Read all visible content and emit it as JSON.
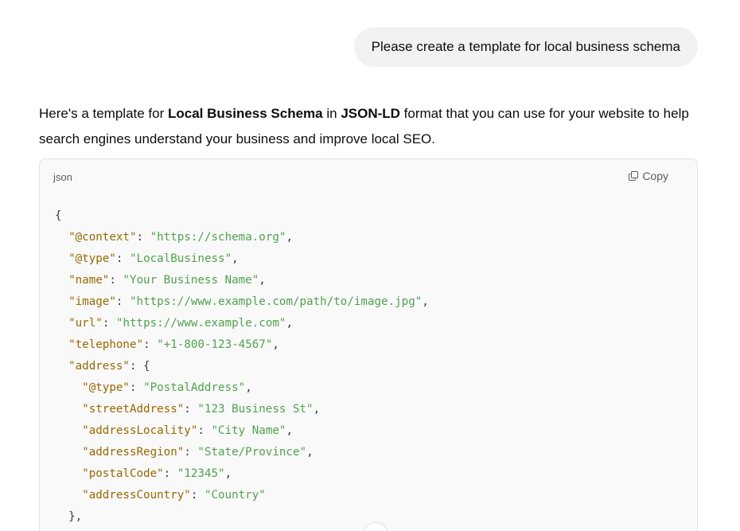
{
  "conversation": {
    "user_message": "Please create a template for local business schema",
    "assistant_intro": {
      "part1": "Here's a template for ",
      "bold1": "Local Business Schema",
      "part2": " in ",
      "bold2": "JSON-LD",
      "part3": " format that you can use for your website to help search engines understand your business and improve local SEO."
    }
  },
  "code_block": {
    "language": "json",
    "copy_label": "Copy",
    "lines": [
      {
        "indent": "",
        "tokens": [
          {
            "t": "p",
            "v": "{"
          }
        ]
      },
      {
        "indent": "  ",
        "tokens": [
          {
            "t": "k",
            "v": "\"@context\""
          },
          {
            "t": "p",
            "v": ": "
          },
          {
            "t": "s",
            "v": "\"https://schema.org\""
          },
          {
            "t": "p",
            "v": ","
          }
        ]
      },
      {
        "indent": "  ",
        "tokens": [
          {
            "t": "k",
            "v": "\"@type\""
          },
          {
            "t": "p",
            "v": ": "
          },
          {
            "t": "s",
            "v": "\"LocalBusiness\""
          },
          {
            "t": "p",
            "v": ","
          }
        ]
      },
      {
        "indent": "  ",
        "tokens": [
          {
            "t": "k",
            "v": "\"name\""
          },
          {
            "t": "p",
            "v": ": "
          },
          {
            "t": "s",
            "v": "\"Your Business Name\""
          },
          {
            "t": "p",
            "v": ","
          }
        ]
      },
      {
        "indent": "  ",
        "tokens": [
          {
            "t": "k",
            "v": "\"image\""
          },
          {
            "t": "p",
            "v": ": "
          },
          {
            "t": "s",
            "v": "\"https://www.example.com/path/to/image.jpg\""
          },
          {
            "t": "p",
            "v": ","
          }
        ]
      },
      {
        "indent": "  ",
        "tokens": [
          {
            "t": "k",
            "v": "\"url\""
          },
          {
            "t": "p",
            "v": ": "
          },
          {
            "t": "s",
            "v": "\"https://www.example.com\""
          },
          {
            "t": "p",
            "v": ","
          }
        ]
      },
      {
        "indent": "  ",
        "tokens": [
          {
            "t": "k",
            "v": "\"telephone\""
          },
          {
            "t": "p",
            "v": ": "
          },
          {
            "t": "s",
            "v": "\"+1-800-123-4567\""
          },
          {
            "t": "p",
            "v": ","
          }
        ]
      },
      {
        "indent": "  ",
        "tokens": [
          {
            "t": "k",
            "v": "\"address\""
          },
          {
            "t": "p",
            "v": ": {"
          }
        ]
      },
      {
        "indent": "    ",
        "tokens": [
          {
            "t": "k",
            "v": "\"@type\""
          },
          {
            "t": "p",
            "v": ": "
          },
          {
            "t": "s",
            "v": "\"PostalAddress\""
          },
          {
            "t": "p",
            "v": ","
          }
        ]
      },
      {
        "indent": "    ",
        "tokens": [
          {
            "t": "k",
            "v": "\"streetAddress\""
          },
          {
            "t": "p",
            "v": ": "
          },
          {
            "t": "s",
            "v": "\"123 Business St\""
          },
          {
            "t": "p",
            "v": ","
          }
        ]
      },
      {
        "indent": "    ",
        "tokens": [
          {
            "t": "k",
            "v": "\"addressLocality\""
          },
          {
            "t": "p",
            "v": ": "
          },
          {
            "t": "s",
            "v": "\"City Name\""
          },
          {
            "t": "p",
            "v": ","
          }
        ]
      },
      {
        "indent": "    ",
        "tokens": [
          {
            "t": "k",
            "v": "\"addressRegion\""
          },
          {
            "t": "p",
            "v": ": "
          },
          {
            "t": "s",
            "v": "\"State/Province\""
          },
          {
            "t": "p",
            "v": ","
          }
        ]
      },
      {
        "indent": "    ",
        "tokens": [
          {
            "t": "k",
            "v": "\"postalCode\""
          },
          {
            "t": "p",
            "v": ": "
          },
          {
            "t": "s",
            "v": "\"12345\""
          },
          {
            "t": "p",
            "v": ","
          }
        ]
      },
      {
        "indent": "    ",
        "tokens": [
          {
            "t": "k",
            "v": "\"addressCountry\""
          },
          {
            "t": "p",
            "v": ": "
          },
          {
            "t": "s",
            "v": "\"Country\""
          }
        ]
      },
      {
        "indent": "  ",
        "tokens": [
          {
            "t": "p",
            "v": "},"
          }
        ]
      }
    ]
  },
  "colors": {
    "key": "#986801",
    "string": "#50a14f",
    "punctuation": "#383a42",
    "bubble_bg": "#f2f2f2",
    "code_bg": "#f9f9f9"
  },
  "icons": {
    "copy": "copy-icon",
    "scroll": "scroll-down-icon"
  }
}
